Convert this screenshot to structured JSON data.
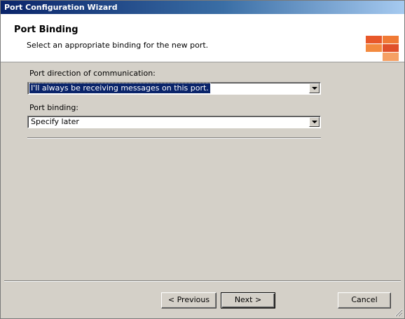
{
  "window": {
    "title": "Port Configuration Wizard"
  },
  "header": {
    "title": "Port Binding",
    "subtitle": "Select an appropriate binding for the new port."
  },
  "form": {
    "direction": {
      "label": "Port direction of communication:",
      "value": "I'll always be receiving messages on this port."
    },
    "binding": {
      "label": "Port binding:",
      "value": "Specify later"
    }
  },
  "buttons": {
    "previous": "< Previous",
    "next": "Next >",
    "cancel": "Cancel"
  },
  "colors": {
    "titlebar_start": "#0a246a",
    "titlebar_end": "#a6caf0",
    "logo_orange": "#f27a2e",
    "dialog_bg": "#d4d0c8"
  },
  "icons": {
    "logo": "orange-grid-logo",
    "size_grip": "resize-grip-icon"
  }
}
